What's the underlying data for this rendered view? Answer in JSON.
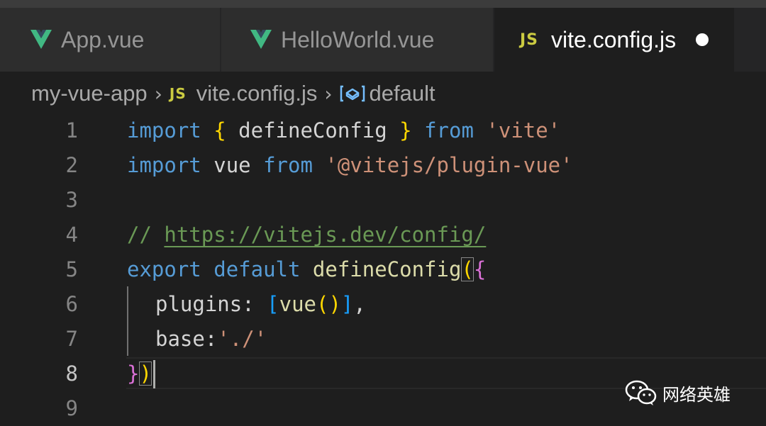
{
  "tabs": [
    {
      "label": "App.vue",
      "icon": "vue-icon",
      "active": false
    },
    {
      "label": "HelloWorld.vue",
      "icon": "vue-icon",
      "active": false
    },
    {
      "label": "vite.config.js",
      "icon": "js-icon",
      "icon_text": "JS",
      "active": true,
      "dirty": true
    }
  ],
  "breadcrumb": {
    "folder": "my-vue-app",
    "file_icon_text": "JS",
    "file": "vite.config.js",
    "symbol": "default"
  },
  "line_numbers": [
    "1",
    "2",
    "3",
    "4",
    "5",
    "6",
    "7",
    "8",
    "9"
  ],
  "code": {
    "l1": {
      "import": "import",
      "open": "{",
      "name": "defineConfig",
      "close": "}",
      "from": "from",
      "module": "'vite'"
    },
    "l2": {
      "import": "import",
      "name": "vue",
      "from": "from",
      "module": "'@vitejs/plugin-vue'"
    },
    "l4": {
      "prefix": "// ",
      "url": "https://vitejs.dev/config/"
    },
    "l5": {
      "export": "export",
      "default": "default",
      "fn": "defineConfig",
      "paren": "(",
      "brace": "{"
    },
    "l6": {
      "key": "plugins",
      "colon": ": ",
      "open": "[",
      "fn": "vue",
      "call": "()",
      "close": "]",
      "comma": ","
    },
    "l7": {
      "key": "base",
      "colon": ":",
      "value": "'./'"
    },
    "l8": {
      "brace": "}",
      "paren": ")"
    }
  },
  "watermark": {
    "text": "网络英雄",
    "icon": "wechat-icon"
  },
  "colors": {
    "keyword": "#569cd6",
    "string": "#ce9178",
    "comment": "#6a9955",
    "function": "#dcdcaa",
    "bracket1": "#ffd700",
    "bracket2": "#da70d6",
    "bracket3": "#179fff",
    "vue_green": "#41b883",
    "js_yellow": "#cbcb41"
  }
}
